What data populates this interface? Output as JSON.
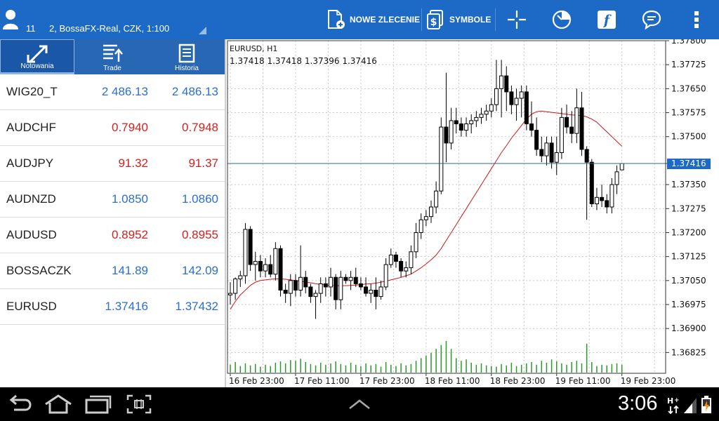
{
  "account": {
    "number": "11",
    "name": "2, BossaFX-Real, CZK, 1:100"
  },
  "toolbar": {
    "new_order": "NOWE ZLECENIE",
    "symbols": "SYMBOLE"
  },
  "tabs": [
    {
      "label": "Notowania",
      "active": true
    },
    {
      "label": "Trade",
      "active": false
    },
    {
      "label": "Historia",
      "active": false
    }
  ],
  "quotes": [
    {
      "symbol": "WIG20_T",
      "bid": "2 486.13",
      "ask": "2 486.13",
      "color": "blue"
    },
    {
      "symbol": "AUDCHF",
      "bid": "0.7940",
      "ask": "0.7948",
      "color": "red"
    },
    {
      "symbol": "AUDJPY",
      "bid": "91.32",
      "ask": "91.37",
      "color": "red"
    },
    {
      "symbol": "AUDNZD",
      "bid": "1.0850",
      "ask": "1.0860",
      "color": "blue"
    },
    {
      "symbol": "AUDUSD",
      "bid": "0.8952",
      "ask": "0.8955",
      "color": "red"
    },
    {
      "symbol": "BOSSACZK",
      "bid": "141.89",
      "ask": "142.09",
      "color": "blue"
    },
    {
      "symbol": "EURUSD",
      "bid": "1.37416",
      "ask": "1.37432",
      "color": "blue"
    }
  ],
  "chart": {
    "symbol_tf": "EURUSD, H1",
    "ohlc": "1.37418 1.37418 1.37396 1.37416",
    "current_price": 1.37416,
    "current_price_label": "1.37416"
  },
  "chart_data": {
    "type": "candlestick",
    "title": "EURUSD, H1",
    "ylim": [
      1.3676,
      1.378
    ],
    "y_ticks": [
      "1.37800",
      "1.37725",
      "1.37650",
      "1.37575",
      "1.37500",
      "1.37416",
      "1.37350",
      "1.37275",
      "1.37200",
      "1.37125",
      "1.37050",
      "1.36975",
      "1.36900",
      "1.36825"
    ],
    "y_tick_values": [
      1.378,
      1.37725,
      1.3765,
      1.37575,
      1.375,
      1.37416,
      1.3735,
      1.37275,
      1.372,
      1.37125,
      1.3705,
      1.36975,
      1.369,
      1.36825
    ],
    "x_ticks": [
      "16 Feb 23:00",
      "17 Feb 11:00",
      "17 Feb 23:00",
      "18 Feb 11:00",
      "18 Feb 23:00",
      "19 Feb 11:00",
      "19 Feb 23:00"
    ],
    "candles": [
      [
        1.37005,
        1.37045,
        1.36975,
        1.3701
      ],
      [
        1.3701,
        1.3706,
        1.3699,
        1.37055
      ],
      [
        1.37055,
        1.3708,
        1.3703,
        1.37065
      ],
      [
        1.37065,
        1.3723,
        1.3704,
        1.3721
      ],
      [
        1.3721,
        1.3722,
        1.3708,
        1.371
      ],
      [
        1.371,
        1.3714,
        1.3705,
        1.3711
      ],
      [
        1.3711,
        1.3713,
        1.3706,
        1.3708
      ],
      [
        1.3708,
        1.3712,
        1.3706,
        1.371
      ],
      [
        1.371,
        1.3713,
        1.3706,
        1.3707
      ],
      [
        1.3707,
        1.3717,
        1.3705,
        1.3715
      ],
      [
        1.3715,
        1.3716,
        1.37,
        1.3702
      ],
      [
        1.3702,
        1.3704,
        1.3698,
        1.3701
      ],
      [
        1.3701,
        1.3707,
        1.3697,
        1.3705
      ],
      [
        1.3705,
        1.3707,
        1.37,
        1.3702
      ],
      [
        1.3702,
        1.3716,
        1.37,
        1.3706
      ],
      [
        1.3706,
        1.3708,
        1.3701,
        1.3703
      ],
      [
        1.3703,
        1.3704,
        1.3698,
        1.37
      ],
      [
        1.37,
        1.3702,
        1.3693,
        1.3701
      ],
      [
        1.3701,
        1.3706,
        1.3698,
        1.3704
      ],
      [
        1.3704,
        1.3706,
        1.37,
        1.3703
      ],
      [
        1.3703,
        1.3709,
        1.37,
        1.3706
      ],
      [
        1.3706,
        1.3707,
        1.3696,
        1.3699
      ],
      [
        1.3699,
        1.3708,
        1.3696,
        1.3706
      ],
      [
        1.3706,
        1.3707,
        1.3704,
        1.3705
      ],
      [
        1.3705,
        1.3708,
        1.3702,
        1.3706
      ],
      [
        1.3706,
        1.3709,
        1.3703,
        1.3704
      ],
      [
        1.3704,
        1.3706,
        1.3702,
        1.3703
      ],
      [
        1.3703,
        1.3706,
        1.37,
        1.3701
      ],
      [
        1.3701,
        1.3704,
        1.3698,
        1.3702
      ],
      [
        1.3702,
        1.3706,
        1.3696,
        1.37
      ],
      [
        1.37,
        1.3705,
        1.3699,
        1.3703
      ],
      [
        1.3703,
        1.3712,
        1.3702,
        1.371
      ],
      [
        1.371,
        1.3715,
        1.3709,
        1.3713
      ],
      [
        1.3713,
        1.3714,
        1.3709,
        1.3711
      ],
      [
        1.3711,
        1.3712,
        1.3706,
        1.3708
      ],
      [
        1.3708,
        1.3711,
        1.3706,
        1.3709
      ],
      [
        1.3709,
        1.3716,
        1.3707,
        1.3714
      ],
      [
        1.3714,
        1.3723,
        1.3712,
        1.372
      ],
      [
        1.372,
        1.3726,
        1.3718,
        1.3724
      ],
      [
        1.3724,
        1.3727,
        1.3722,
        1.3725
      ],
      [
        1.3725,
        1.373,
        1.3723,
        1.3728
      ],
      [
        1.3728,
        1.3736,
        1.3726,
        1.3733
      ],
      [
        1.3733,
        1.3756,
        1.3732,
        1.3753
      ],
      [
        1.3753,
        1.377,
        1.3742,
        1.3748
      ],
      [
        1.3748,
        1.3759,
        1.3746,
        1.3755
      ],
      [
        1.3755,
        1.3759,
        1.3751,
        1.3754
      ],
      [
        1.3754,
        1.3756,
        1.375,
        1.3752
      ],
      [
        1.3752,
        1.3756,
        1.375,
        1.3754
      ],
      [
        1.3754,
        1.3757,
        1.3751,
        1.3755
      ],
      [
        1.3755,
        1.3758,
        1.3753,
        1.3756
      ],
      [
        1.3756,
        1.3759,
        1.3754,
        1.3757
      ],
      [
        1.3757,
        1.376,
        1.3755,
        1.3758
      ],
      [
        1.3758,
        1.3762,
        1.3756,
        1.376
      ],
      [
        1.376,
        1.3774,
        1.3758,
        1.3765
      ],
      [
        1.3765,
        1.3774,
        1.3756,
        1.3769
      ],
      [
        1.3769,
        1.3772,
        1.3758,
        1.3764
      ],
      [
        1.3764,
        1.3766,
        1.3757,
        1.376
      ],
      [
        1.376,
        1.3765,
        1.3755,
        1.3762
      ],
      [
        1.3762,
        1.3766,
        1.3756,
        1.3764
      ],
      [
        1.3764,
        1.3766,
        1.3752,
        1.3754
      ],
      [
        1.3754,
        1.3761,
        1.375,
        1.3752
      ],
      [
        1.3752,
        1.3756,
        1.3744,
        1.3746
      ],
      [
        1.3746,
        1.375,
        1.3742,
        1.3744
      ],
      [
        1.3744,
        1.375,
        1.3741,
        1.3748
      ],
      [
        1.3748,
        1.375,
        1.374,
        1.3742
      ],
      [
        1.3742,
        1.375,
        1.3738,
        1.3745
      ],
      [
        1.3745,
        1.3759,
        1.3743,
        1.3756
      ],
      [
        1.3756,
        1.376,
        1.3751,
        1.3753
      ],
      [
        1.3753,
        1.3758,
        1.3748,
        1.3751
      ],
      [
        1.3751,
        1.3765,
        1.3748,
        1.3759
      ],
      [
        1.3759,
        1.3764,
        1.3744,
        1.3746
      ],
      [
        1.3746,
        1.3747,
        1.3724,
        1.3742
      ],
      [
        1.3742,
        1.3743,
        1.3728,
        1.3729
      ],
      [
        1.3729,
        1.3734,
        1.3727,
        1.3731
      ],
      [
        1.3731,
        1.3735,
        1.3728,
        1.373
      ],
      [
        1.373,
        1.3732,
        1.3726,
        1.3728
      ],
      [
        1.3728,
        1.3737,
        1.3726,
        1.3735
      ],
      [
        1.3735,
        1.3741,
        1.3732,
        1.3739
      ],
      [
        1.37396,
        1.37418,
        1.37396,
        1.37416
      ]
    ],
    "ma": [
      1.3696,
      1.36985,
      1.37005,
      1.3702,
      1.37035,
      1.37045,
      1.3705,
      1.37052,
      1.37054,
      1.37055,
      1.37055,
      1.37054,
      1.37052,
      1.3705,
      1.37048,
      1.37045,
      1.37043,
      1.3704,
      1.37038,
      1.37036,
      1.37035,
      1.37034,
      1.37034,
      1.37034,
      1.37035,
      1.37036,
      1.37037,
      1.37039,
      1.3704,
      1.37042,
      1.37045,
      1.37048,
      1.37052,
      1.37056,
      1.3706,
      1.37065,
      1.3707,
      1.3708,
      1.3709,
      1.37102,
      1.37115,
      1.3713,
      1.3715,
      1.37175,
      1.372,
      1.37225,
      1.3725,
      1.37275,
      1.373,
      1.37325,
      1.3735,
      1.37375,
      1.374,
      1.37425,
      1.3745,
      1.37472,
      1.37495,
      1.37515,
      1.37535,
      1.37555,
      1.3757,
      1.37578,
      1.3758,
      1.37578,
      1.37576,
      1.37574,
      1.37572,
      1.3757,
      1.37568,
      1.37567,
      1.37566,
      1.37562,
      1.37555,
      1.37545,
      1.3753,
      1.37515,
      1.375,
      1.37485,
      1.3747
    ],
    "volume": [
      12,
      16,
      10,
      14,
      11,
      13,
      9,
      12,
      10,
      15,
      17,
      14,
      19,
      18,
      21,
      16,
      13,
      11,
      15,
      12,
      14,
      17,
      13,
      11,
      15,
      12,
      10,
      14,
      11,
      13,
      9,
      16,
      12,
      10,
      14,
      11,
      13,
      18,
      22,
      26,
      30,
      36,
      42,
      48,
      36,
      22,
      18,
      20,
      15,
      12,
      14,
      11,
      10,
      9,
      13,
      11,
      15,
      10,
      12,
      14,
      16,
      12,
      18,
      15,
      20,
      17,
      14,
      12,
      16,
      18,
      14,
      44,
      16,
      10,
      12,
      11,
      13,
      14,
      12
    ]
  }
}
